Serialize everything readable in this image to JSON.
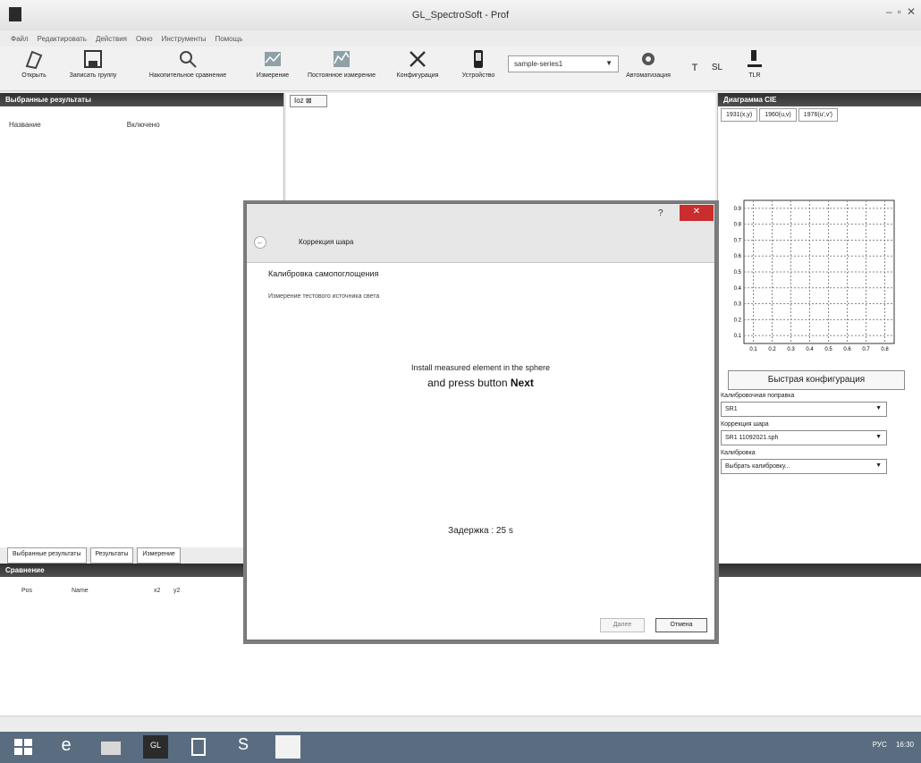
{
  "window": {
    "title": "GL_SpectroSoft - Prof",
    "controls": [
      "–",
      "▫",
      "✕"
    ]
  },
  "menu": [
    "Файл",
    "Редактировать",
    "Действия",
    "Окно",
    "Инструменты",
    "Помощь"
  ],
  "toolbar": {
    "open": "Открыть",
    "save_group": "Записать группу",
    "reference_compare": "Накопительное сравнение",
    "measurement": "Измерение",
    "continuous_measurement": "Постоянное измерение",
    "configuration": "Конфигурация",
    "device": "Устройство",
    "device_select": "sample-series1",
    "automation": "Автоматизация",
    "extra1": "T",
    "extra2": "SL",
    "extra3": "TLR"
  },
  "left_panel": {
    "header": "Выбранные результаты",
    "col_name": "Название",
    "col_status": "Включено"
  },
  "left_tabs": [
    "Выбранные результаты",
    "Результаты",
    "Измерение"
  ],
  "bottom_panel": {
    "header": "Сравнение",
    "cols": [
      "Pos",
      "Name",
      "x2",
      "y2"
    ]
  },
  "center": {
    "tab": "Ioz"
  },
  "right_panel": {
    "header": "Диаграмма CIE",
    "tabs": [
      "1931(x,y)",
      "1960(u,v)",
      "1976(u',v')"
    ],
    "quick_config": "Быстрая конфигурация",
    "fields": [
      {
        "label": "Калибровочная поправка",
        "value": "SR1"
      },
      {
        "label": "Коррекция шара",
        "value": "SR1 11092021.sph"
      },
      {
        "label": "Калибровка",
        "value": "Выбрать калибровку..."
      }
    ]
  },
  "dialog": {
    "title": "Коррекция шара",
    "help": "?",
    "close": "✕",
    "heading": "Калибровка самопоглощения",
    "subheading": "Измерение тестового источника света",
    "message_line1": "Install measured element in the sphere",
    "message_line2_prefix": "and press button ",
    "message_line2_bold": "Next",
    "delay": "Задержка : 25 s",
    "btn_next": "Далее",
    "btn_cancel": "Отмена"
  },
  "chart_data": {
    "type": "scatter",
    "y_ticks": [
      "0.9",
      "0.8",
      "0.7",
      "0.6",
      "0.5",
      "0.4",
      "0.3",
      "0.2",
      "0.1"
    ],
    "x_ticks": [
      "0.1",
      "0.2",
      "0.3",
      "0.4",
      "0.5",
      "0.6",
      "0.7",
      "0.8"
    ],
    "grid": true
  },
  "taskbar": {
    "tray_lang": "РУС",
    "tray_time": "16:30"
  }
}
